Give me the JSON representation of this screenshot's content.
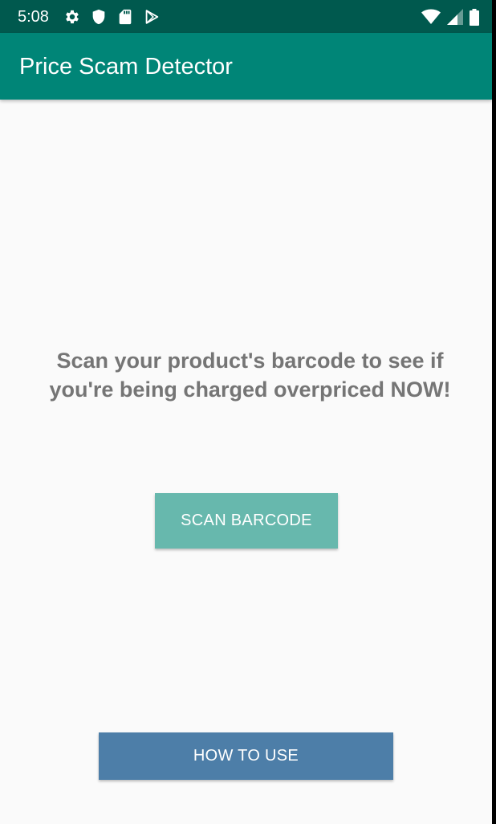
{
  "status_bar": {
    "time": "5:08",
    "left_icons": [
      "settings-icon",
      "shield-icon",
      "sd-card-icon",
      "play-store-icon"
    ],
    "right_icons": [
      "wifi-icon",
      "cell-signal-icon",
      "battery-icon"
    ]
  },
  "app_bar": {
    "title": "Price Scam Detector"
  },
  "main": {
    "message": "Scan your product's barcode to see if you're being charged overpriced NOW!",
    "scan_button_label": "SCAN BARCODE",
    "how_to_use_button_label": "HOW TO USE"
  },
  "colors": {
    "status_bar": "#00594e",
    "app_bar": "#008577",
    "background": "#fafafa",
    "message_text": "#757575",
    "scan_button": "#67b8ad",
    "how_to_use_button": "#4d7ea8"
  }
}
